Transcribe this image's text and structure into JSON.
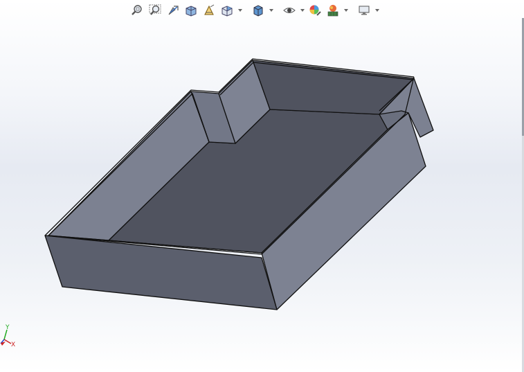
{
  "toolbar": {
    "buttons": [
      {
        "name": "zoom-to-fit-icon",
        "dropdown": false
      },
      {
        "name": "zoom-to-area-icon",
        "dropdown": false
      },
      {
        "name": "previous-view-icon",
        "dropdown": false
      },
      {
        "name": "section-view-icon",
        "dropdown": false
      },
      {
        "name": "dynamic-annotation-views-icon",
        "dropdown": false
      },
      {
        "name": "view-orientation-icon",
        "dropdown": true
      },
      {
        "name": "display-style-icon",
        "dropdown": true
      },
      {
        "name": "hide-show-items-icon",
        "dropdown": true
      },
      {
        "name": "edit-appearance-icon",
        "dropdown": false
      },
      {
        "name": "apply-scene-icon",
        "dropdown": true
      },
      {
        "name": "view-settings-icon",
        "dropdown": true
      }
    ]
  },
  "triad": {
    "x_label": "X",
    "y_label": "Y",
    "x_color": "#cc2222",
    "y_color": "#22aa22",
    "z_color": "#2244cc"
  },
  "model": {
    "face_top_color": "#7a8090",
    "face_floor_color": "#50535f",
    "face_side_color": "#5b5f6d",
    "face_front_color": "#686c7a",
    "edge_color": "#111111"
  }
}
